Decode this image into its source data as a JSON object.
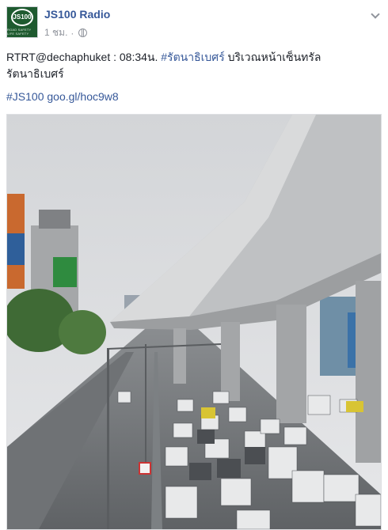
{
  "post": {
    "page_name": "JS100 Radio",
    "timestamp": "1 ชม.",
    "separator": "·",
    "text_prefix": "RTRT@dechaphuket : 08:34น. ",
    "hashtag_location": "#รัตนาธิเบศร์",
    "text_suffix": " บริเวณหน้าเซ็นทรัลรัตนาธิเบศร์",
    "hashtag_station": "#JS100",
    "short_link": "goo.gl/hoc9w8"
  },
  "avatar": {
    "logo_text": "JS100",
    "logo_tagline": "ROAD SAFETY LIFE SAFETY"
  },
  "icons": {
    "audience": "globe-icon",
    "menu": "chevron-down-icon"
  },
  "colors": {
    "link": "#365899",
    "meta": "#90949c",
    "logo_bg": "#1e5a2f"
  }
}
